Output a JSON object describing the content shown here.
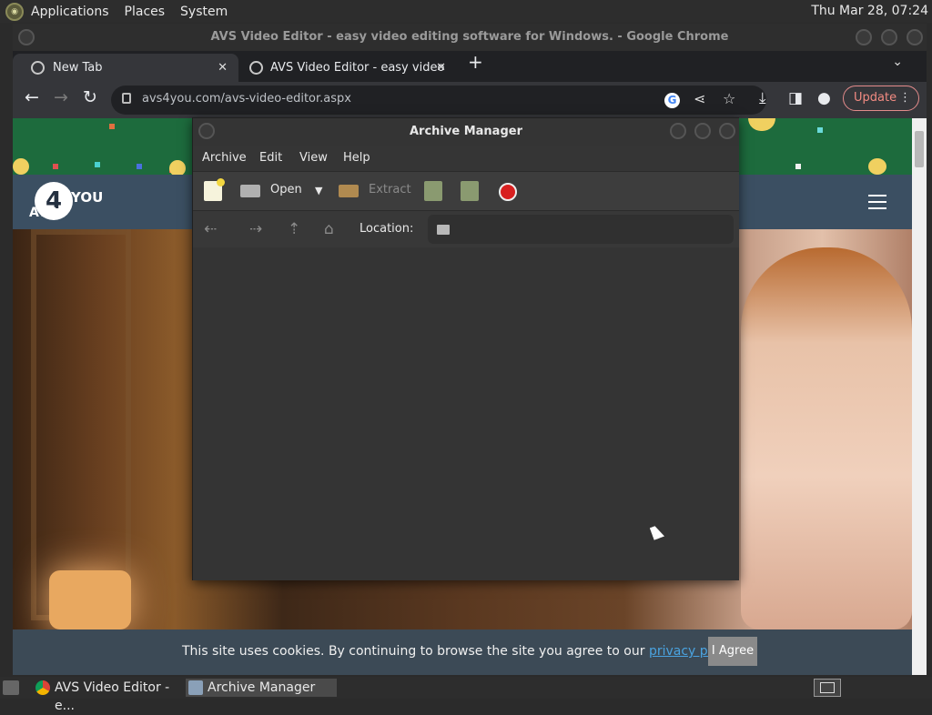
{
  "desktop": {
    "menus": [
      "Applications",
      "Places",
      "System"
    ],
    "clock": "Thu Mar 28, 07:24"
  },
  "chrome": {
    "window_title": "AVS Video Editor - easy video editing software for Windows. - Google Chrome",
    "tabs": [
      {
        "label": "New Tab",
        "close": "✕"
      },
      {
        "label": "AVS Video Editor - easy video",
        "close": "✕"
      }
    ],
    "new_tab": "+",
    "tab_menu": "⌄",
    "url": "avs4you.com/avs-video-editor.aspx",
    "update_label": "Update",
    "more": "⋮",
    "google_badge": "G"
  },
  "site": {
    "logo_digit": "4",
    "logo_you": "YOU",
    "logo_avs": "AVS",
    "cookie_text": "This site uses cookies. By continuing to browse the site you agree to our ",
    "cookie_link": "privacy policy",
    "cookie_period": ".",
    "agree_label": "I Agree"
  },
  "archive_manager": {
    "title": "Archive Manager",
    "menu": [
      "Archive",
      "Edit",
      "View",
      "Help"
    ],
    "toolbar": {
      "open_label": "Open",
      "extract_label": "Extract"
    },
    "location_label": "Location:"
  },
  "taskbar": {
    "tasks": [
      "AVS Video Editor - e...",
      "Archive Manager"
    ]
  },
  "colors": {
    "accent_update": "#f28b82",
    "link": "#4aa3e0",
    "stop_red": "#d82020"
  }
}
